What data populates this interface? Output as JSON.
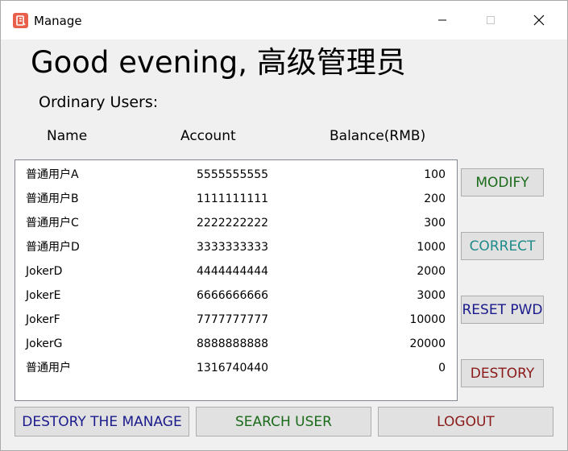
{
  "window": {
    "title": "Manage"
  },
  "header": {
    "greeting": "Good evening, 高级管理员",
    "section_label": "Ordinary Users:"
  },
  "columns": {
    "name": "Name",
    "account": "Account",
    "balance": "Balance(RMB)"
  },
  "users": [
    {
      "name": "普通用户A",
      "account": "5555555555",
      "balance": "100"
    },
    {
      "name": "普通用户B",
      "account": "1111111111",
      "balance": "200"
    },
    {
      "name": "普通用户C",
      "account": "2222222222",
      "balance": "300"
    },
    {
      "name": "普通用户D",
      "account": "3333333333",
      "balance": "1000"
    },
    {
      "name": "JokerD",
      "account": "4444444444",
      "balance": "2000"
    },
    {
      "name": "JokerE",
      "account": "6666666666",
      "balance": "3000"
    },
    {
      "name": "JokerF",
      "account": "7777777777",
      "balance": "10000"
    },
    {
      "name": "JokerG",
      "account": "8888888888",
      "balance": "20000"
    },
    {
      "name": "普通用户",
      "account": "1316740440",
      "balance": "0"
    }
  ],
  "side_buttons": {
    "modify": "MODIFY",
    "correct": "CORRECT",
    "reset_pwd": "RESET PWD",
    "destory": "DESTORY"
  },
  "bottom_buttons": {
    "destory_manage": "DESTORY THE MANAGE",
    "search_user": "SEARCH USER",
    "logout": "LOGOUT"
  },
  "colors": {
    "modify": "#1a6b1a",
    "correct": "#1f8a8a",
    "reset_pwd": "#1a1a8c",
    "destory": "#8b1a1a",
    "destory_manage": "#1a1a8c",
    "search_user": "#1a6b1a",
    "logout": "#8b1a1a",
    "app_icon": "#e8604c"
  },
  "icons": {
    "app": "app-icon",
    "minimize": "minimize-icon",
    "maximize": "maximize-icon",
    "close": "close-icon"
  }
}
